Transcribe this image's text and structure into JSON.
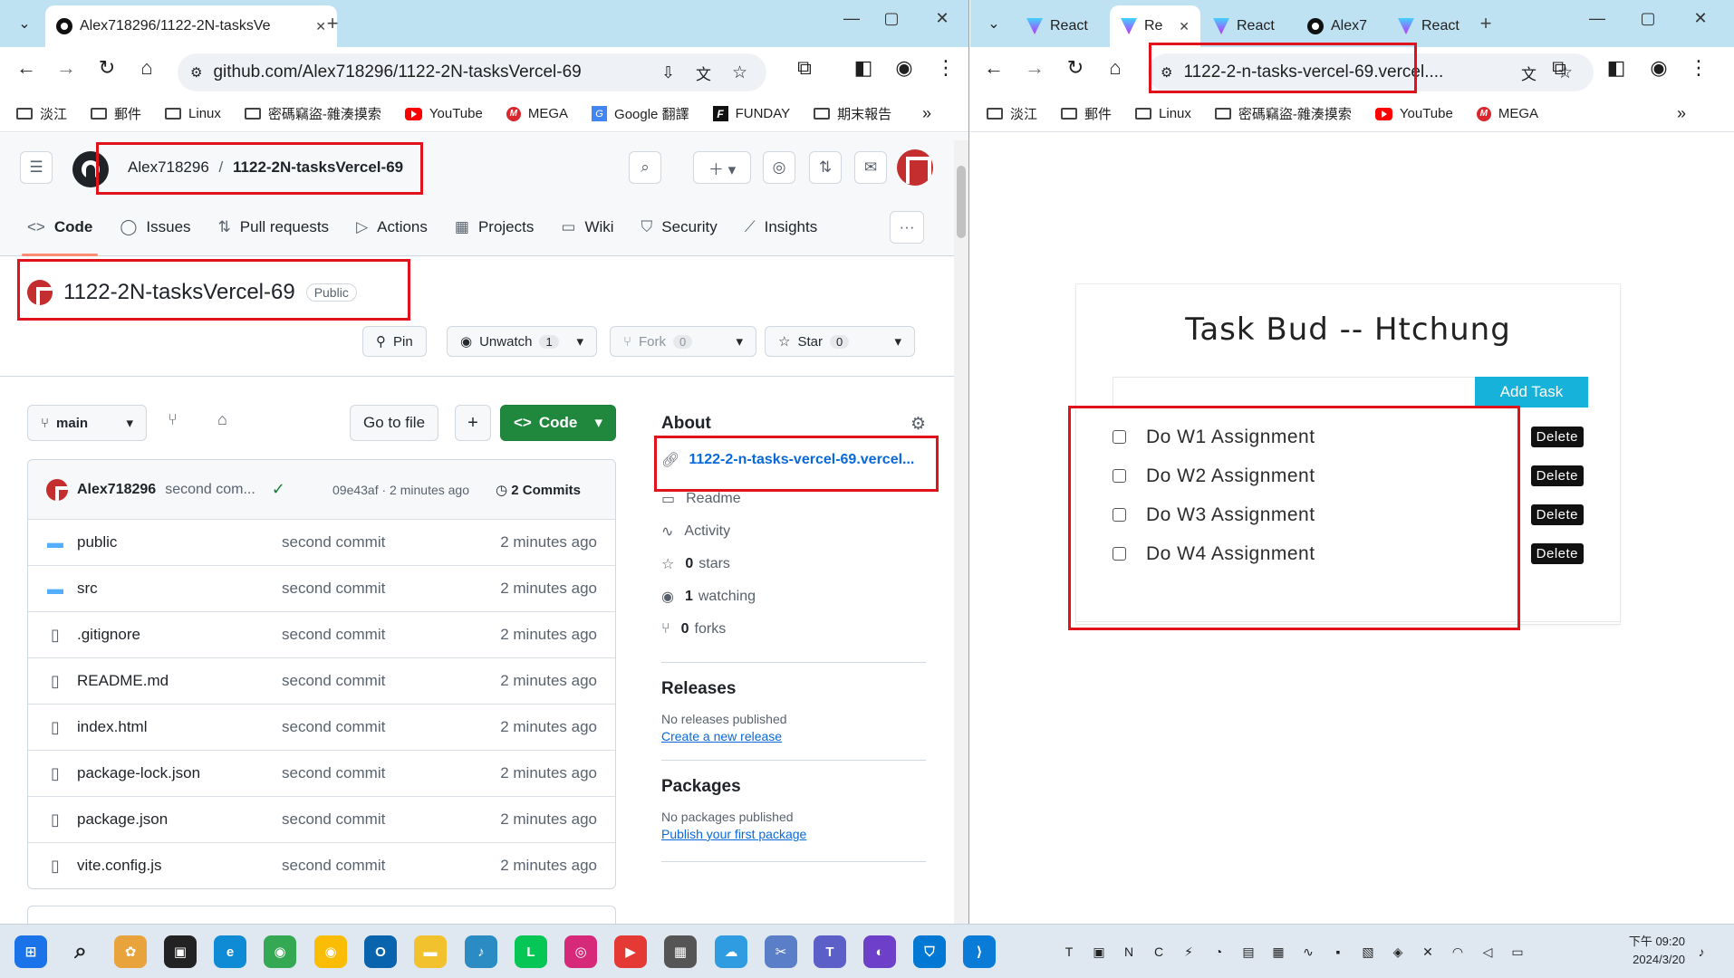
{
  "left_browser": {
    "tab": {
      "title": "Alex718296/1122-2N-tasksVe",
      "close": "✕"
    },
    "new_tab": "+",
    "address": "github.com/Alex718296/1122-2N-tasksVercel-69",
    "window_controls": [
      "—",
      "▢",
      "✕"
    ],
    "bookmarks": [
      "淡江",
      "郵件",
      "Linux",
      "密碼竊盜-雜湊摸索",
      "YouTube",
      "MEGA",
      "Google 翻譯",
      "FUNDAY",
      "期末報告"
    ],
    "bookmarks_more": "»"
  },
  "github": {
    "breadcrumb": {
      "owner": "Alex718296",
      "sep": "/",
      "repo": "1122-2N-tasksVercel-69"
    },
    "nav": [
      {
        "label": "Code",
        "icon": "code-icon",
        "glyph": "<>"
      },
      {
        "label": "Issues",
        "icon": "issue-icon",
        "glyph": "◯"
      },
      {
        "label": "Pull requests",
        "icon": "pull-request-icon",
        "glyph": "⇅"
      },
      {
        "label": "Actions",
        "icon": "play-icon",
        "glyph": "▷"
      },
      {
        "label": "Projects",
        "icon": "table-icon",
        "glyph": "▦"
      },
      {
        "label": "Wiki",
        "icon": "book-icon",
        "glyph": "▭"
      },
      {
        "label": "Security",
        "icon": "shield-icon",
        "glyph": "⛉"
      },
      {
        "label": "Insights",
        "icon": "graph-icon",
        "glyph": "⟋"
      }
    ],
    "nav_more": "···",
    "repo_title": "1122-2N-tasksVercel-69",
    "visibility": "Public",
    "actions": {
      "pin": "Pin",
      "unwatch": "Unwatch",
      "unwatch_count": "1",
      "fork": "Fork",
      "fork_count": "0",
      "star": "Star",
      "star_count": "0"
    },
    "branch": "main",
    "go_to_file": "Go to file",
    "add": "+",
    "code_button": "Code",
    "latest_commit": {
      "author": "Alex718296",
      "message": "second com...",
      "check": "✓",
      "sha_time": "09e43af · 2 minutes ago",
      "commits": "2 Commits"
    },
    "files": [
      {
        "name": "public",
        "type": "folder",
        "message": "second commit",
        "age": "2 minutes ago"
      },
      {
        "name": "src",
        "type": "folder",
        "message": "second commit",
        "age": "2 minutes ago"
      },
      {
        "name": ".gitignore",
        "type": "file",
        "message": "second commit",
        "age": "2 minutes ago"
      },
      {
        "name": "README.md",
        "type": "file",
        "message": "second commit",
        "age": "2 minutes ago"
      },
      {
        "name": "index.html",
        "type": "file",
        "message": "second commit",
        "age": "2 minutes ago"
      },
      {
        "name": "package-lock.json",
        "type": "file",
        "message": "second commit",
        "age": "2 minutes ago"
      },
      {
        "name": "package.json",
        "type": "file",
        "message": "second commit",
        "age": "2 minutes ago"
      },
      {
        "name": "vite.config.js",
        "type": "file",
        "message": "second commit",
        "age": "2 minutes ago"
      }
    ],
    "about": {
      "heading": "About",
      "website": "1122-2-n-tasks-vercel-69.vercel...",
      "readme": "Readme",
      "activity": "Activity",
      "stars_count": "0",
      "stars_label": "stars",
      "watching_count": "1",
      "watching_label": "watching",
      "forks_count": "0",
      "forks_label": "forks"
    },
    "releases": {
      "heading": "Releases",
      "empty": "No releases published",
      "link": "Create a new release"
    },
    "packages": {
      "heading": "Packages",
      "empty": "No packages published",
      "link": "Publish your first package"
    }
  },
  "right_browser": {
    "tabs": [
      {
        "title": "React",
        "icon": "vite"
      },
      {
        "title": "Re",
        "icon": "vite",
        "active": true
      },
      {
        "title": "React",
        "icon": "vite"
      },
      {
        "title": "Alex7",
        "icon": "github"
      },
      {
        "title": "React",
        "icon": "vite"
      }
    ],
    "tab_close": "✕",
    "new_tab": "+",
    "window_controls": [
      "—",
      "▢",
      "✕"
    ],
    "address": "1122-2-n-tasks-vercel-69.vercel....",
    "bookmarks": [
      "淡江",
      "郵件",
      "Linux",
      "密碼竊盜-雜湊摸索",
      "YouTube",
      "MEGA"
    ],
    "bookmarks_more": "»"
  },
  "taskbud": {
    "title": "Task Bud -- Htchung",
    "input_value": "",
    "add_button": "Add Task",
    "tasks": [
      {
        "text": "Do W1 Assignment",
        "done": false
      },
      {
        "text": "Do W2 Assignment",
        "done": false
      },
      {
        "text": "Do W3 Assignment",
        "done": false
      },
      {
        "text": "Do W4 Assignment",
        "done": false
      }
    ],
    "delete_label": "Delete"
  },
  "taskbar": {
    "time": "下午 09:20",
    "date": "2024/3/20",
    "apps": [
      {
        "name": "start",
        "color": "#1a73e8",
        "glyph": "⊞"
      },
      {
        "name": "search",
        "color": "transparent",
        "glyph": "⌕"
      },
      {
        "name": "copilot",
        "color": "#e8a33d",
        "glyph": "✿"
      },
      {
        "name": "task-view",
        "color": "#222222",
        "glyph": "▣"
      },
      {
        "name": "edge",
        "color": "#0f8bd6",
        "glyph": "e"
      },
      {
        "name": "chrome",
        "color": "#34a853",
        "glyph": "◉"
      },
      {
        "name": "chrome-profile",
        "color": "#fbbc05",
        "glyph": "◉"
      },
      {
        "name": "outlook",
        "color": "#0a64ad",
        "glyph": "O"
      },
      {
        "name": "file-explorer",
        "color": "#f2c12e",
        "glyph": "▬"
      },
      {
        "name": "music",
        "color": "#2b8cc4",
        "glyph": "♪"
      },
      {
        "name": "line",
        "color": "#06c755",
        "glyph": "L"
      },
      {
        "name": "instagram",
        "color": "#d6297a",
        "glyph": "◎"
      },
      {
        "name": "media-player",
        "color": "#e53935",
        "glyph": "▶"
      },
      {
        "name": "calculator",
        "color": "#555555",
        "glyph": "▦"
      },
      {
        "name": "weather",
        "color": "#2f9be0",
        "glyph": "☁"
      },
      {
        "name": "snipping",
        "color": "#5b7ec8",
        "glyph": "✂"
      },
      {
        "name": "teams",
        "color": "#5b5fc7",
        "glyph": "T"
      },
      {
        "name": "github-desktop",
        "color": "#6e40c9",
        "glyph": "◐"
      },
      {
        "name": "defender",
        "color": "#0078d4",
        "glyph": "⛉"
      },
      {
        "name": "vscode",
        "color": "#0a7bd6",
        "glyph": "⟩"
      }
    ],
    "tray": [
      "T",
      "▣",
      "N",
      "C",
      "⚡",
      "◔",
      "▤",
      "▦",
      "∿",
      "▪",
      "▧",
      "◈",
      "✕",
      "◠",
      "◁",
      "▭"
    ]
  }
}
